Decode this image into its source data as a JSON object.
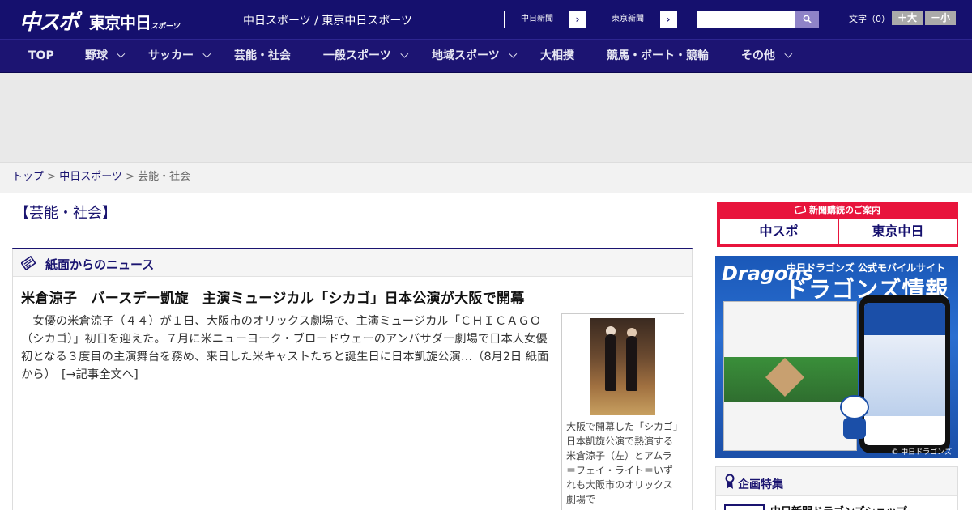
{
  "header": {
    "logo_chuspo": "中スポ",
    "logo_tokyo": "東京中日",
    "logo_tokyo_small": "スポーツ",
    "tagline": "中日スポーツ / 東京中日スポーツ",
    "paper_links": [
      "中日新聞",
      "東京新聞"
    ],
    "search": {
      "placeholder": "",
      "button_icon": "search-icon"
    },
    "font_size": {
      "label": "文字（0）",
      "plus_label": "＋大",
      "minus_label": "－小"
    }
  },
  "nav": {
    "items": [
      {
        "label": "TOP",
        "has_dropdown": false
      },
      {
        "label": "野球",
        "has_dropdown": true
      },
      {
        "label": "サッカー",
        "has_dropdown": true
      },
      {
        "label": "芸能・社会",
        "has_dropdown": false
      },
      {
        "label": "一般スポーツ",
        "has_dropdown": true
      },
      {
        "label": "地域スポーツ",
        "has_dropdown": true
      },
      {
        "label": "大相撲",
        "has_dropdown": false
      },
      {
        "label": "競馬・ボート・競輪",
        "has_dropdown": false
      },
      {
        "label": "その他",
        "has_dropdown": true
      }
    ]
  },
  "breadcrumb": {
    "items": [
      "トップ",
      "中日スポーツ",
      "芸能・社会"
    ],
    "separator": " > "
  },
  "main": {
    "section_title": "【芸能・社会】",
    "news_box": {
      "title": "紙面からのニュース",
      "headline": "米倉涼子　バースデー凱旋　主演ミュージカル「シカゴ」日本公演が大阪で開幕",
      "body": "女優の米倉涼子（４４）が１日、大阪市のオリックス劇場で、主演ミュージカル「ＣＨＩＣＡＧＯ（シカゴ）」初日を迎えた。７月に米ニューヨーク・ブロードウェーのアンバサダー劇場で日本人女優初となる３度目の主演舞台を務め、来日した米キャストたちと誕生日に日本凱旋公演…（8月2日 紙面から）　",
      "read_more": "[→記事全文へ]",
      "photo_caption": "大阪で開幕した「シカゴ」日本凱旋公演で熱演する米倉涼子（左）とアムラ＝フェイ・ライト＝いずれも大阪市のオリックス劇場で"
    }
  },
  "sidebar": {
    "subscribe": {
      "title": "新聞購読のご案内",
      "logos": [
        "中スポ",
        "東京中日"
      ]
    },
    "dragons_banner": {
      "logo": "Dragons",
      "subtitle": "中日ドラゴンズ 公式モバイルサイト",
      "title": "ドラゴンズ情報",
      "footer": "© 中日ドラゴンズ"
    },
    "kikaku": {
      "title": "企画特集",
      "first_item": "中日新聞ドラゴンズショップ"
    }
  },
  "colors": {
    "header_bg": "#15106e",
    "nav_bg": "#1c1472",
    "accent_red": "#e8143c",
    "link": "#1a1470"
  }
}
